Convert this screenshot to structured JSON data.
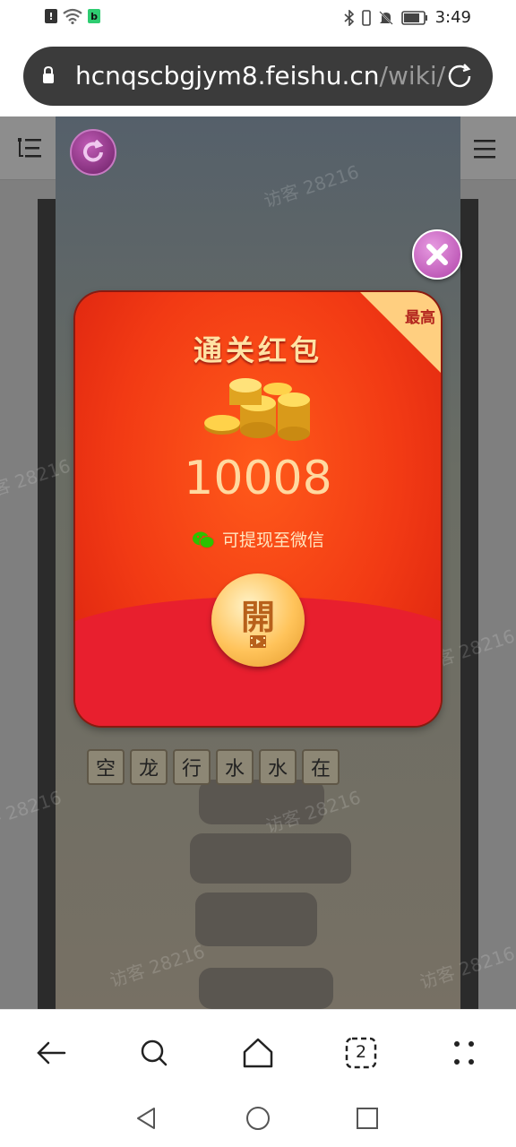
{
  "status_bar": {
    "time": "3:49",
    "left_icons": [
      "alert-icon",
      "wifi-icon",
      "b-app-icon"
    ],
    "right_icons": [
      "bluetooth-icon",
      "vibrate-icon",
      "mute-icon",
      "battery-icon"
    ]
  },
  "url_bar": {
    "domain": "hcnqscbgjym8.feishu.cn",
    "path": "/wiki/"
  },
  "watermark": "访客 28216",
  "redpacket": {
    "corner_label": "最高",
    "title": "通关红包",
    "amount": "10008",
    "withdraw_text": "可提现至微信",
    "open_label": "開"
  },
  "tiles": [
    "空",
    "龙",
    "行",
    "水",
    "水",
    "在"
  ],
  "nav_bar": {
    "tab_count": "2",
    "items": [
      "back-icon",
      "search-icon",
      "home-icon",
      "tabs-icon",
      "more-icon"
    ]
  },
  "colors": {
    "packet_red": "#f23a14",
    "packet_gold": "#ffd9a0",
    "url_bar_bg": "#3b3b3b"
  }
}
